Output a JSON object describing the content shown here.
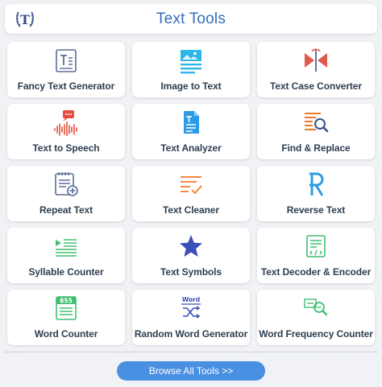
{
  "header": {
    "title": "Text Tools",
    "logo_letter": "T",
    "logo_icon": "laurel-t-logo"
  },
  "tools": [
    {
      "label": "Fancy Text Generator",
      "icon": "fancy-text-icon",
      "color": "#5b6b9a"
    },
    {
      "label": "Image to Text",
      "icon": "image-to-text-icon",
      "color": "#2eb6e8"
    },
    {
      "label": "Text Case Converter",
      "icon": "text-case-icon",
      "color": "#e05a4e"
    },
    {
      "label": "Text to Speech",
      "icon": "text-to-speech-icon",
      "color": "#e74c3c"
    },
    {
      "label": "Text Analyzer",
      "icon": "text-analyzer-icon",
      "color": "#2d9be6"
    },
    {
      "label": "Find & Replace",
      "icon": "find-replace-icon",
      "color": "#f07a2a"
    },
    {
      "label": "Repeat Text",
      "icon": "repeat-text-icon",
      "color": "#5b6b9a"
    },
    {
      "label": "Text Cleaner",
      "icon": "text-cleaner-icon",
      "color": "#f07a2a"
    },
    {
      "label": "Reverse Text",
      "icon": "reverse-text-icon",
      "color": "#2d9be6"
    },
    {
      "label": "Syllable Counter",
      "icon": "syllable-counter-icon",
      "color": "#3fbf6f"
    },
    {
      "label": "Text Symbols",
      "icon": "star-icon",
      "color": "#3a4fb8"
    },
    {
      "label": "Text Decoder & Encoder",
      "icon": "decoder-encoder-icon",
      "color": "#3fbf6f"
    },
    {
      "label": "Word Counter",
      "icon": "word-counter-icon",
      "color": "#3fbf6f",
      "icon_text": "855"
    },
    {
      "label": "Random Word Generator",
      "icon": "random-word-icon",
      "color": "#3a4fb8",
      "icon_text": "Word"
    },
    {
      "label": "Word Frequency Counter",
      "icon": "word-frequency-icon",
      "color": "#3fbf6f"
    }
  ],
  "browse_button": {
    "label": "Browse All Tools >>",
    "color": "#4a90e2"
  }
}
